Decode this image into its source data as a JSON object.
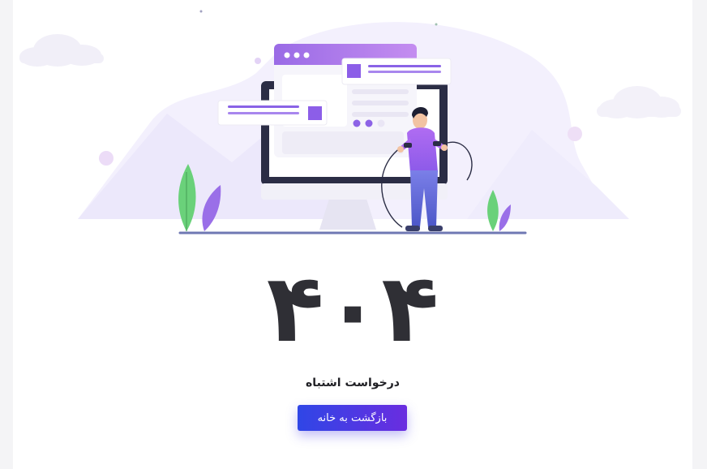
{
  "error": {
    "code": "۴۰۴",
    "message": "درخواست اشتباه"
  },
  "actions": {
    "home_button_label": "بازگشت به خانه"
  },
  "colors": {
    "accent_start": "#2f46e6",
    "accent_end": "#6a2de0",
    "code_color": "#2f2f35"
  },
  "illustration": {
    "icon": "developer-at-monitor-illustration"
  }
}
